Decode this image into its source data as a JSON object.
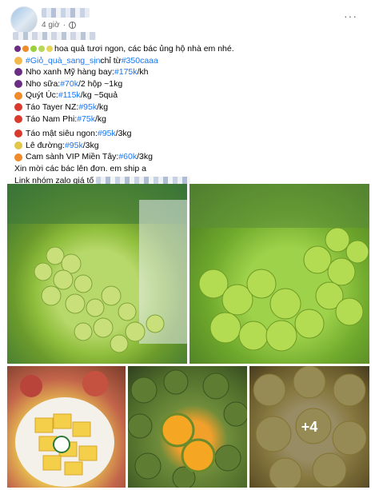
{
  "post": {
    "timestamp": "4 giờ",
    "privacy_icon": "globe-icon",
    "more_icon": "more-options-icon",
    "more_label": "···"
  },
  "content": {
    "lines": [
      {
        "icons": [
          "#6b2d83",
          "#f08a2b",
          "#9bcf3b",
          "#b7d858",
          "#e7d35a"
        ],
        "text": "hoa quả tươi ngon, các bác ủng hộ nhà em nhé."
      },
      {
        "icons": [
          "#f2b84b"
        ],
        "tag": "#Giỏ_quà_sang_sịn",
        "text": " chỉ từ ",
        "tag2": "#350caaa"
      },
      {
        "icons": [
          "#6b2d83"
        ],
        "text": "Nho xanh Mỹ hàng bay: ",
        "tag": "#175k",
        "suffix": "/kh"
      },
      {
        "icons": [
          "#6b2d83"
        ],
        "text": "Nho sữa: ",
        "tag": "#70k",
        "suffix": "/2 hộp ~1kg"
      },
      {
        "icons": [
          "#f08a2b"
        ],
        "text": "Quýt Úc: ",
        "tag": "#115k",
        "suffix": "/kg ~5quả"
      },
      {
        "icons": [
          "#d83a2e"
        ],
        "text": "Táo Tayer NZ: ",
        "tag": "#95k",
        "suffix": "/kg"
      },
      {
        "icons": [
          "#d83a2e"
        ],
        "text": "Táo Nam Phi: ",
        "tag": "#75k",
        "suffix": "/kg"
      },
      {
        "gap": true
      },
      {
        "icons": [
          "#d83a2e"
        ],
        "text": "Táo mật siêu ngon: ",
        "tag": "#95k",
        "suffix": "/3kg"
      },
      {
        "icons": [
          "#e2c64a"
        ],
        "text": "Lê đường: ",
        "tag": "#95k",
        "suffix": "/3kg"
      },
      {
        "icons": [
          "#f08a2b"
        ],
        "text": "Cam sành VIP Miền Tây: ",
        "tag": "#60k",
        "suffix": "/3kg"
      },
      {
        "text": "Xin mời các bác lên đơn. em ship a"
      },
      {
        "text": "Link nhóm zalo giá tố",
        "blurred": true
      }
    ]
  },
  "photos": [
    {
      "name": "grapes-boxed-photo"
    },
    {
      "name": "green-grapes-closeup-photo"
    },
    {
      "name": "pineapple-plate-photo"
    },
    {
      "name": "oranges-halved-photo"
    },
    {
      "name": "pears-photo",
      "more_count": "+4"
    }
  ]
}
